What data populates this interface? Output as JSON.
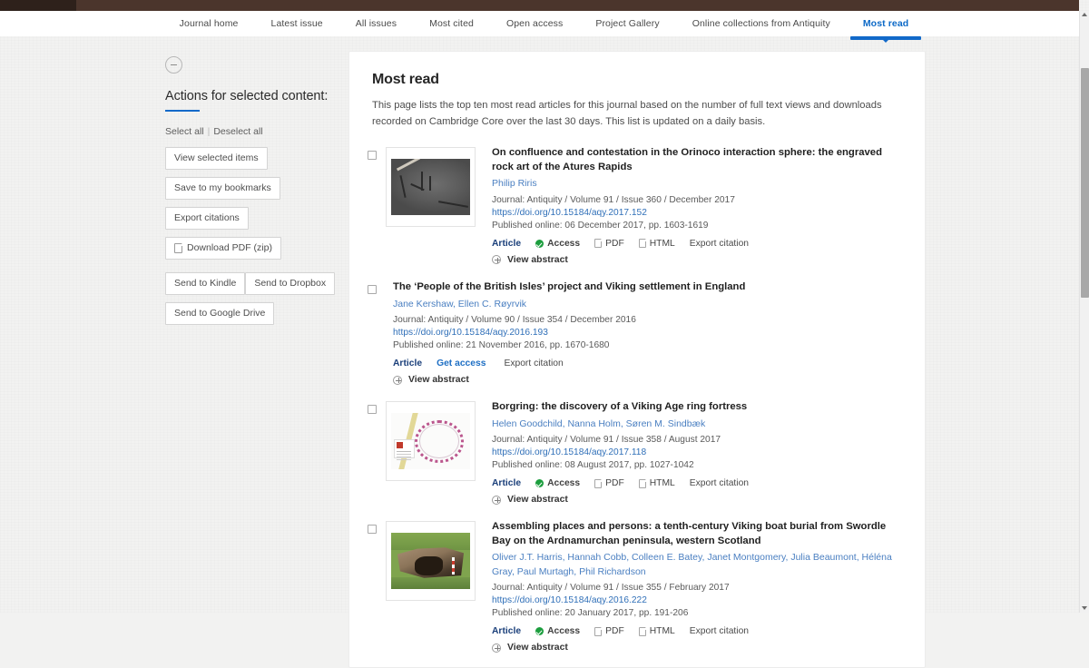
{
  "banner": {
    "color": "#4b352c"
  },
  "nav": {
    "items": [
      {
        "label": "Journal home",
        "active": false
      },
      {
        "label": "Latest issue",
        "active": false
      },
      {
        "label": "All issues",
        "active": false
      },
      {
        "label": "Most cited",
        "active": false
      },
      {
        "label": "Open access",
        "active": false
      },
      {
        "label": "Project Gallery",
        "active": false
      },
      {
        "label": "Online collections from Antiquity",
        "active": false
      },
      {
        "label": "Most read",
        "active": true
      }
    ],
    "active_color": "#1269c9"
  },
  "sidebar": {
    "collapse_icon": "circle-minus-icon",
    "title": "Actions for selected content:",
    "select_all": "Select all",
    "separator": "|",
    "deselect_all": "Deselect all",
    "buttons": [
      {
        "label": "View selected items",
        "icon": null
      },
      {
        "label": "Save to my bookmarks",
        "icon": null
      },
      {
        "label": "Export citations",
        "icon": null
      },
      {
        "label": "Download PDF (zip)",
        "icon": "pdf-icon"
      },
      {
        "label": "Send to Kindle",
        "icon": null
      },
      {
        "label": "Send to Dropbox",
        "icon": null
      },
      {
        "label": "Send to Google Drive",
        "icon": null
      }
    ]
  },
  "main": {
    "title": "Most read",
    "description": "This page lists the top ten most read articles for this journal based on the number of full text views and downloads recorded on Cambridge Core over the last 30 days. This list is updated on a daily basis.",
    "articles": [
      {
        "title": "On confluence and contestation in the Orinoco interaction sphere: the engraved rock art of the Atures Rapids",
        "authors": "Philip Riris",
        "journal": "Journal: Antiquity / Volume 91 / Issue 360 / December 2017",
        "doi": "https://doi.org/10.15184/aqy.2017.152",
        "published": "Published online: 06 December 2017, pp. 1603-1619",
        "thumb": "rock",
        "actions": {
          "article": "Article",
          "access": "Access",
          "pdf": "PDF",
          "html": "HTML",
          "export": "Export citation"
        },
        "abstract": "View abstract"
      },
      {
        "title": "The ‘People of the British Isles’ project and Viking settlement in England",
        "authors": "Jane Kershaw, Ellen C. Røyrvik",
        "journal": "Journal: Antiquity / Volume 90 / Issue 354 / December 2016",
        "doi": "https://doi.org/10.15184/aqy.2016.193",
        "published": "Published online: 21 November 2016, pp. 1670-1680",
        "thumb": null,
        "actions": {
          "article": "Article",
          "get_access": "Get access",
          "export": "Export citation"
        },
        "abstract": "View abstract"
      },
      {
        "title": "Borgring: the discovery of a Viking Age ring fortress",
        "authors": "Helen Goodchild, Nanna Holm, Søren M. Sindbæk",
        "journal": "Journal: Antiquity / Volume 91 / Issue 358 / August 2017",
        "doi": "https://doi.org/10.15184/aqy.2017.118",
        "published": "Published online: 08 August 2017, pp. 1027-1042",
        "thumb": "map",
        "actions": {
          "article": "Article",
          "access": "Access",
          "pdf": "PDF",
          "html": "HTML",
          "export": "Export citation"
        },
        "abstract": "View abstract"
      },
      {
        "title": "Assembling places and persons: a tenth-century Viking boat burial from Swordle Bay on the Ardnamurchan peninsula, western Scotland",
        "authors": "Oliver J.T. Harris, Hannah Cobb, Colleen E. Batey, Janet Montgomery, Julia Beaumont, Héléna Gray, Paul Murtagh, Phil Richardson",
        "journal": "Journal: Antiquity / Volume 91 / Issue 355 / February 2017",
        "doi": "https://doi.org/10.15184/aqy.2016.222",
        "published": "Published online: 20 January 2017, pp. 191-206",
        "thumb": "dig",
        "actions": {
          "article": "Article",
          "access": "Access",
          "pdf": "PDF",
          "html": "HTML",
          "export": "Export citation"
        },
        "abstract": "View abstract"
      }
    ]
  }
}
